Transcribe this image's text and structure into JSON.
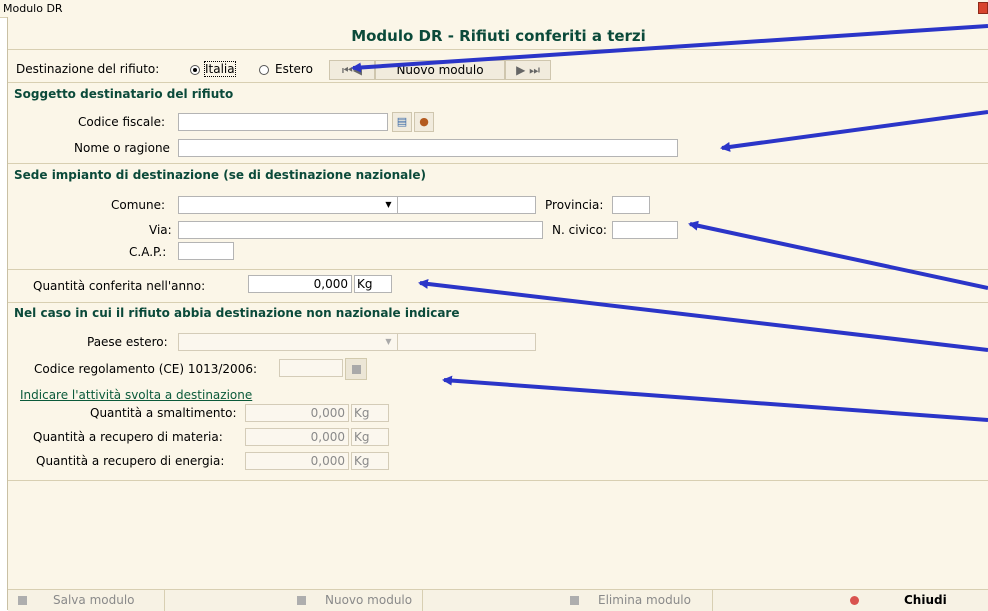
{
  "window": {
    "title": "Modulo DR"
  },
  "header": {
    "title": "Modulo DR - Rifiuti conferiti a terzi"
  },
  "destination": {
    "label": "Destinazione del rifiuto:",
    "options": [
      {
        "label": "Italia",
        "selected": true
      },
      {
        "label": "Estero",
        "selected": false
      }
    ]
  },
  "nav": {
    "first_icon": "first-record-icon",
    "prev_icon": "prev-record-icon",
    "new_label": "Nuovo modulo",
    "next_icon": "next-record-icon",
    "last_icon": "last-record-icon"
  },
  "soggetto": {
    "section_title": "Soggetto destinatario del rifiuto",
    "codice_fiscale_label": "Codice fiscale:",
    "codice_fiscale_value": "",
    "nome_label": "Nome o ragione",
    "nome_value": ""
  },
  "sede": {
    "section_title": "Sede impianto di destinazione (se di destinazione nazionale)",
    "comune_label": "Comune:",
    "provincia_label": "Provincia:",
    "via_label": "Via:",
    "civico_label": "N. civico:",
    "cap_label": "C.A.P.:"
  },
  "quantita": {
    "label": "Quantità conferita nell'anno:",
    "value": "0,000",
    "unit": "Kg"
  },
  "estero": {
    "section_title": "Nel caso in cui il rifiuto abbia destinazione non nazionale indicare",
    "paese_label": "Paese estero:",
    "codice_label": "Codice regolamento (CE) 1013/2006:",
    "attivita_link": "Indicare l'attività svolta a destinazione",
    "smaltimento_label": "Quantità a smaltimento:",
    "smaltimento_value": "0,000",
    "materia_label": "Quantità a recupero di materia:",
    "materia_value": "0,000",
    "energia_label": "Quantità a recupero di energia:",
    "energia_value": "0,000",
    "unit": "Kg"
  },
  "footer": {
    "save_label": "Salva modulo",
    "new_label": "Nuovo modulo",
    "delete_label": "Elimina modulo",
    "close_label": "Chiudi"
  },
  "colors": {
    "accent": "#0b4a3a",
    "background": "#fbf6e8",
    "arrow": "#2b35c8"
  }
}
